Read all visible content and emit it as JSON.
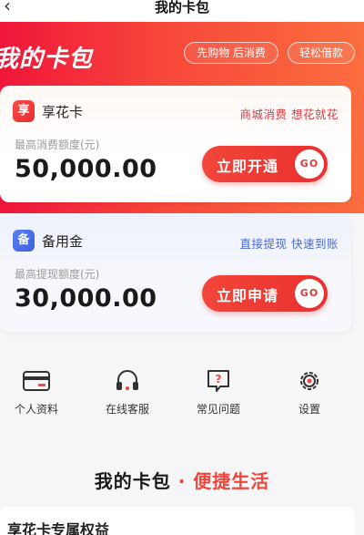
{
  "nav": {
    "title": "我的卡包"
  },
  "hero": {
    "title": "我的卡包",
    "pills": [
      "先购物 后消费",
      "轻松借款"
    ]
  },
  "cards": [
    {
      "icon_char": "享",
      "icon": "xianghua-icon",
      "name": "享花卡",
      "slogan": "商城消费 想花就花",
      "sub_label": "最高消费额度(元)",
      "amount": "50,000.00",
      "cta": "立即开通",
      "go": "GO"
    },
    {
      "icon_char": "备",
      "icon": "beiyongjin-icon",
      "name": "备用金",
      "slogan": "直接提现 快速到账",
      "sub_label": "最高提现额度(元)",
      "amount": "30,000.00",
      "cta": "立即申请",
      "go": "GO"
    }
  ],
  "quick": [
    {
      "label": "个人资料",
      "icon": "id-card-icon"
    },
    {
      "label": "在线客服",
      "icon": "headset-icon"
    },
    {
      "label": "常见问题",
      "icon": "question-icon"
    },
    {
      "label": "设置",
      "icon": "gear-icon"
    }
  ],
  "section": {
    "title_main": "我的卡包",
    "title_sep": " · ",
    "title_accent": "便捷生活"
  },
  "benefits": {
    "title": "享花卡专属权益"
  },
  "colors": {
    "brand_red": "#ea2f2f",
    "brand_blue": "#4a6bd6"
  }
}
